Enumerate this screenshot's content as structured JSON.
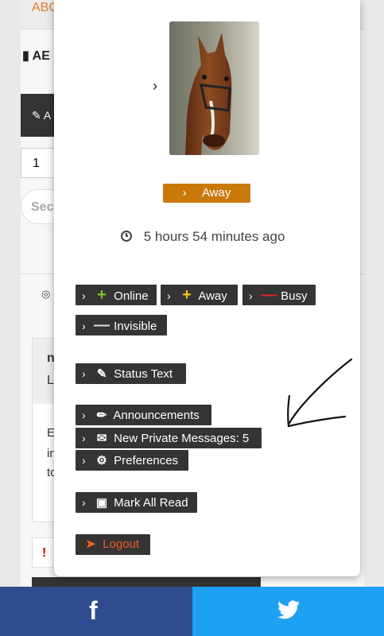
{
  "background": {
    "header_text": "ABC",
    "title": "AE",
    "dark_button": "A",
    "page_number": "1",
    "search_placeholder": "Sec",
    "card": {
      "line1": "n",
      "line2": "L",
      "t1": "E",
      "t2": "in",
      "t3": "tc"
    },
    "alert": "!"
  },
  "user_panel": {
    "status": "Away",
    "last_seen": "5 hours 54 minutes ago",
    "status_options": [
      "Online",
      "Away",
      "Busy",
      "Invisible"
    ],
    "status_text": "Status Text",
    "announcements": "Announcements",
    "private_messages": "New Private Messages: 5",
    "preferences": "Preferences",
    "mark_all_read": "Mark All Read",
    "logout": "Logout"
  },
  "colors": {
    "away": "#c9780a",
    "button": "#343434",
    "online_icon": "#7bc62d",
    "away_icon": "#f3c21b",
    "busy_icon": "#e2231a",
    "logout": "#f05a28",
    "facebook": "#2e4c8f",
    "twitter": "#1da1f2"
  },
  "share_bar": {
    "facebook_icon": "f",
    "twitter_icon": "twitter-icon"
  }
}
